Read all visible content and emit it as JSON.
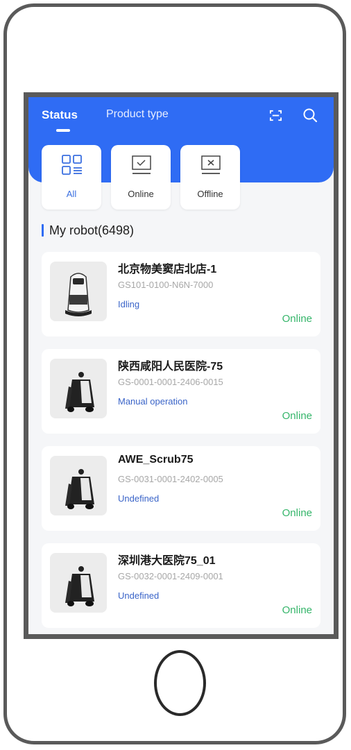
{
  "header": {
    "tab_status": "Status",
    "tab_product_type": "Product type"
  },
  "filters": [
    {
      "label": "All",
      "icon": "grid-list-icon",
      "active": true
    },
    {
      "label": "Online",
      "icon": "monitor-check-icon",
      "active": false
    },
    {
      "label": "Offline",
      "icon": "monitor-x-icon",
      "active": false
    }
  ],
  "section": {
    "title": "My robot(6498)"
  },
  "robots": [
    {
      "name": "北京物美窦店北店-1",
      "serial": "GS101-0100-N6N-7000",
      "state": "Idling",
      "connection": "Online",
      "image": "delivery-robot"
    },
    {
      "name": "陕西咸阳人民医院-75",
      "serial": "GS-0001-0001-2406-0015",
      "state": "Manual operation",
      "connection": "Online",
      "image": "scrubber-robot"
    },
    {
      "name": "AWE_Scrub75",
      "serial": "GS-0031-0001-2402-0005",
      "state": "Undefined",
      "connection": "Online",
      "image": "scrubber-robot"
    },
    {
      "name": "深圳港大医院75_01",
      "serial": "GS-0032-0001-2409-0001",
      "state": "Undefined",
      "connection": "Online",
      "image": "scrubber-robot"
    }
  ],
  "colors": {
    "accent": "#2f6cf4",
    "online": "#35b56a",
    "state": "#3a64c8",
    "frame": "#5a5a5a"
  }
}
